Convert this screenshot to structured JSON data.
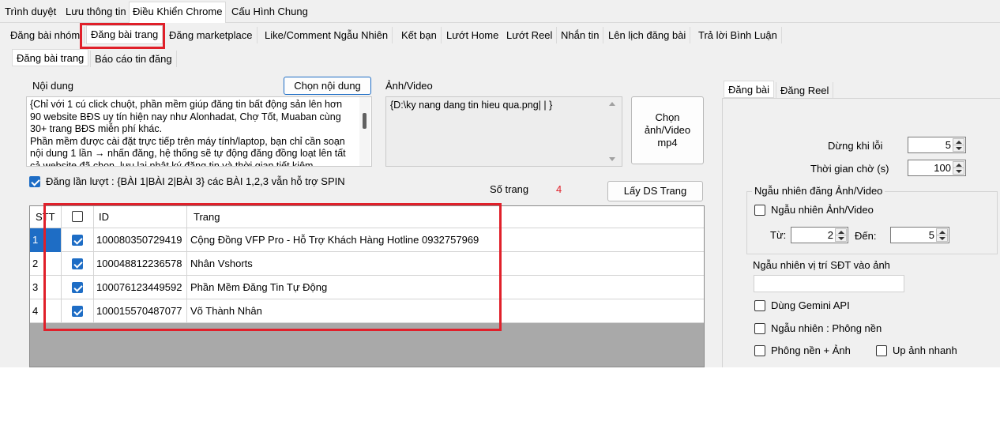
{
  "main_tabs": [
    "Trình duyệt",
    "Lưu thông tin",
    "Điều Khiển Chrome",
    "Cấu Hình Chung"
  ],
  "sub_tabs": [
    "Đăng bài nhóm",
    "Đăng bài trang",
    "Đăng marketplace",
    "Like/Comment Ngẫu Nhiên",
    "Kết bạn",
    "Lướt Home",
    "Lướt Reel",
    "Nhắn tin",
    "Lên lịch đăng bài",
    "Trả lời Bình Luận"
  ],
  "inner_tabs": [
    "Đăng bài trang",
    "Báo cáo tin đăng"
  ],
  "content": {
    "label": "Nội dung",
    "choose_button": "Chọn nội dung",
    "text": "{Chỉ với 1 cú click chuột, phần mềm giúp đăng tin bất động sản lên hơn 90 website BĐS uy tín hiện nay như Alonhadat, Chợ Tốt, Muaban cùng 30+ trang BĐS miễn phí khác.\nPhần mềm được cài đặt trực tiếp trên máy tính/laptop, bạn chỉ cần soạn nội dung 1 lần → nhấn đăng, hệ thống sẽ tự động đăng đồng loạt lên tất cả website đã chọn, lưu lại nhật ký đăng tin và thời gian tiết kiệm"
  },
  "media": {
    "label": "Ảnh/Video",
    "path": "{D:\\ky nang dang tin hieu qua.png| | }",
    "choose_button": "Chọn ảnh/Video mp4"
  },
  "post_in_turn": {
    "checked": true,
    "label": "Đăng lần lượt : {BÀI 1|BÀI 2|BÀI 3} các BÀI 1,2,3 vẫn hỗ trợ SPIN"
  },
  "page_count": {
    "label": "Số trang",
    "value": "4"
  },
  "get_pages_button": "Lấy DS Trang",
  "table": {
    "headers": {
      "stt": "STT",
      "id": "ID",
      "page": "Trang"
    },
    "rows": [
      {
        "stt": "1",
        "checked": true,
        "id": "100080350729419",
        "page": "Cộng Đồng VFP Pro - Hỗ Trợ Khách Hàng Hotline 0932757969"
      },
      {
        "stt": "2",
        "checked": true,
        "id": "100048812236578",
        "page": "Nhân Vshorts"
      },
      {
        "stt": "3",
        "checked": true,
        "id": "100076123449592",
        "page": "Phần Mềm Đăng Tin Tự Động"
      },
      {
        "stt": "4",
        "checked": true,
        "id": "100015570487077",
        "page": "Võ Thành Nhân"
      }
    ]
  },
  "right_tabs": [
    "Đăng bài",
    "Đăng Reel"
  ],
  "settings": {
    "stop_on_error_label": "Dừng khi lỗi",
    "stop_on_error_value": "5",
    "wait_time_label": "Thời gian chờ (s)",
    "wait_time_value": "100",
    "random_group_label": "Ngẫu nhiên đăng Ảnh/Video",
    "random_media_label": "Ngẫu nhiên Ảnh/Video",
    "from_label": "Từ:",
    "from_value": "2",
    "to_label": "Đến:",
    "to_value": "5",
    "random_phone_label": "Ngẫu nhiên vị trí SĐT vào ảnh",
    "random_phone_value": "",
    "gemini_label": "Dùng Gemini API",
    "random_bg_label": "Ngẫu nhiên : Phông nền",
    "bg_image_label": "Phông nền + Ảnh",
    "fast_upload_label": "Up ảnh nhanh"
  },
  "colors": {
    "accent": "#1e6dc5",
    "highlight": "#e0202a",
    "count_red": "#e0202a"
  }
}
